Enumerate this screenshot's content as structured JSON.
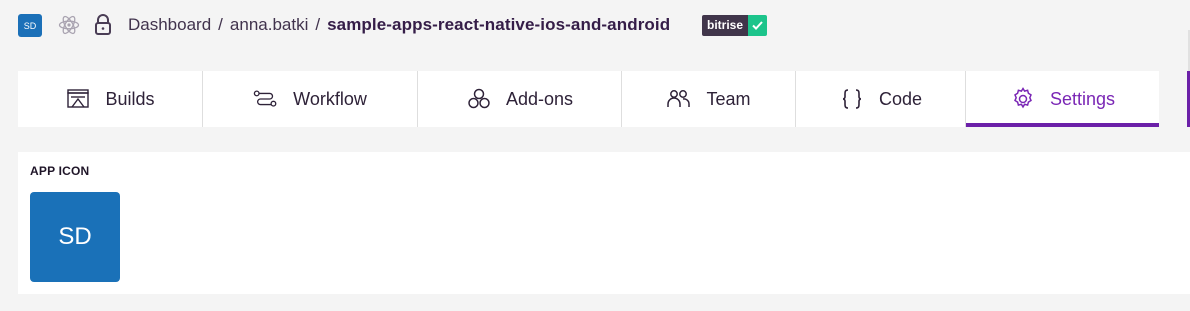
{
  "header": {
    "app_initials": "SD",
    "breadcrumb": {
      "dashboard": "Dashboard",
      "sep1": "/",
      "owner": "anna.batki",
      "sep2": "/",
      "app_name": "sample-apps-react-native-ios-and-android"
    },
    "badge_label": "bitrise"
  },
  "tabs": [
    {
      "label": "Builds",
      "icon": "builds-icon"
    },
    {
      "label": "Workflow",
      "icon": "workflow-icon"
    },
    {
      "label": "Add-ons",
      "icon": "addons-icon"
    },
    {
      "label": "Team",
      "icon": "team-icon"
    },
    {
      "label": "Code",
      "icon": "code-icon"
    },
    {
      "label": "Settings",
      "icon": "settings-icon",
      "active": true
    }
  ],
  "settings": {
    "app_icon_title": "APP ICON",
    "app_icon_initials": "SD"
  },
  "colors": {
    "accent": "#7a26b5",
    "app_icon_bg": "#1a71b8",
    "badge_check": "#1cc48b"
  }
}
